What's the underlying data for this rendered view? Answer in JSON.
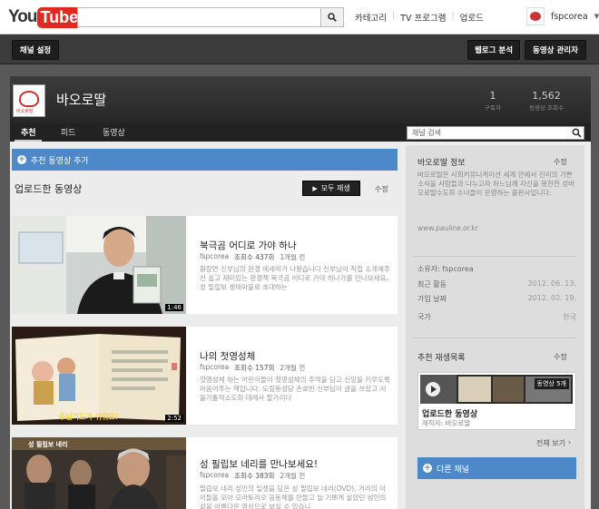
{
  "header": {
    "logo_you": "You",
    "logo_tube": "Tube",
    "search": {
      "value": "",
      "placeholder": ""
    },
    "links": [
      "카테고리",
      "TV 프로그램",
      "업로드"
    ],
    "username": "fspcorea"
  },
  "toolbar": {
    "channel_settings": "채널 설정",
    "analytics": "웹로그 분석",
    "video_manager": "동영상 관리자"
  },
  "channel": {
    "avatar_text": "바오로딸",
    "title": "바오로딸",
    "stats": [
      {
        "value": "1",
        "label": "구독자"
      },
      {
        "value": "1,562",
        "label": "동영상 조회수"
      }
    ],
    "tabs": [
      "추천",
      "피드",
      "동영상"
    ],
    "search_placeholder": "채널 검색"
  },
  "main": {
    "add_featured": "추천 동영상 추가",
    "section_title": "업로드한 동영상",
    "play_all": "모두 재생",
    "edit": "수정",
    "videos": [
      {
        "title": "북극곰 어디로 가야 하나",
        "author": "fspcorea",
        "views": "조회수 437회",
        "age": "1개월 전",
        "duration": "1:46",
        "desc": "황창연 신부님의 환경 에세이가 나왔습니다 신부님이 직접 소개해주신 쉽고 재미있는 환경책 북극곰 어디로 가야 하나가를 만나보세요. 성 필립보 생태마을로 초대하는"
      },
      {
        "title": "나의 첫영성체",
        "author": "fspcorea",
        "views": "조회수 157회",
        "age": "2개월 전",
        "duration": "2:52",
        "desc": "첫영성체 하는 어린이들이 첫영성체의 추억을 담고 신앙을 키우도록 마음어주는 책입니다. 도림동성당 손호빈 신부님이 글을 쓰셨고 서울가톨릭소도회 데레사 팔가리다",
        "overlay": "주님기도가 쉬워요!"
      },
      {
        "title": "성 필립보 네리를 만나보세요!",
        "author": "fspcorea",
        "views": "조회수 383회",
        "age": "2개월 전",
        "duration": "",
        "desc": "필립보 네리 성인의 일생을 담은 성 필립보 네리(DVD), 거리의 아이들을 모아 오라토리오 공동체를 만들고 늘 기쁘게 살았던 성인의 삶을 아름다운 영상으로 보실 수 있습니",
        "overlay": "성 필립보 네리"
      }
    ]
  },
  "sidebar": {
    "info_title": "바오로딸 정보",
    "edit": "수정",
    "description": "바오로딸은 사회커뮤니케이션 세계 안에서 진리의 기쁜 소식을 사람들과 나누고자 하느님께 자신을 봉헌한 성바오로딸수도회 수녀들이 운영하는 출판사입니다.",
    "url": "www.pauline.or.kr",
    "owner": "소유자: fspcorea",
    "rows": [
      {
        "key": "최근 활동",
        "value": "2012. 06. 13."
      },
      {
        "key": "가입 날짜",
        "value": "2012. 02. 19."
      },
      {
        "key": "국가",
        "value": "한국"
      }
    ],
    "playlist_title": "추천 재생목록",
    "playlist_badge": "동영상 5개",
    "playlist_name": "업로드한 동영상",
    "playlist_author": "제작자: 바오로딸",
    "see_all": "전체 보기",
    "other_channels": "다른 채널"
  },
  "colors": {
    "accent_blue": "#4d88c8",
    "youtube_red": "#e02a20"
  }
}
